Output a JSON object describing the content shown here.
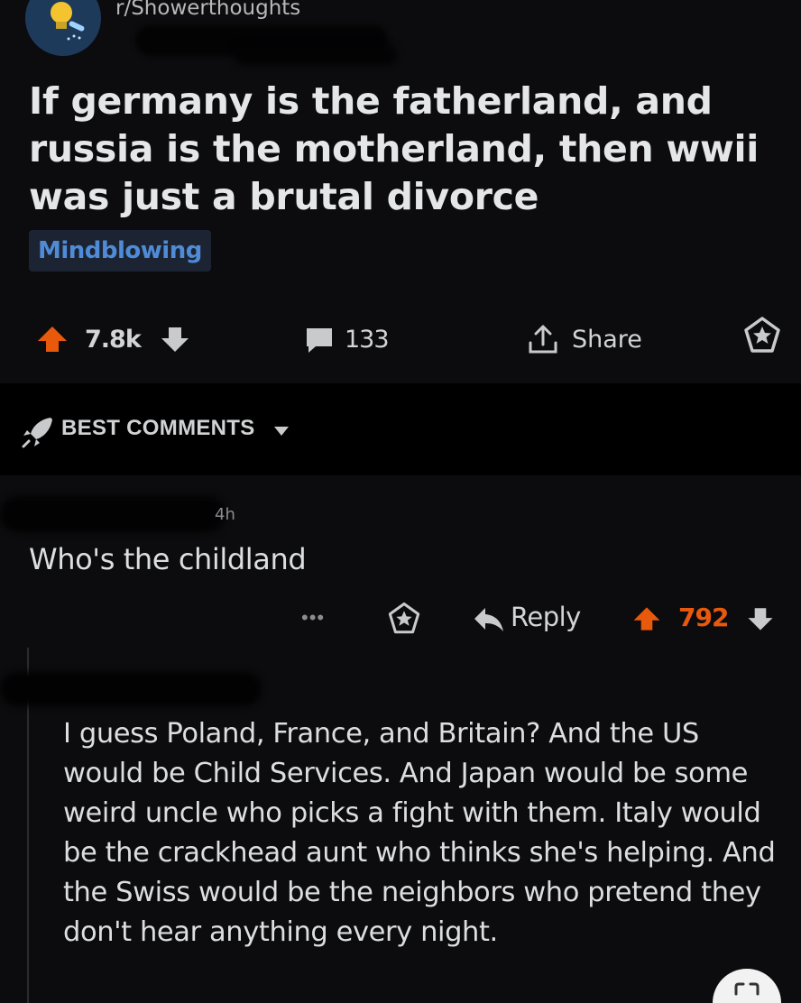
{
  "post": {
    "subreddit": "r/Showerthoughts",
    "title": "If germany is the fatherland, and russia is the motherland, then wwii was just a brutal divorce",
    "flair": "Mindblowing",
    "votes": "7.8k",
    "comments": "133",
    "share_label": "Share"
  },
  "sort": {
    "label": "BEST COMMENTS"
  },
  "comments": [
    {
      "time": "4h",
      "body": "Who's the childland",
      "reply_label": "Reply",
      "votes": "792",
      "more": "•••"
    },
    {
      "body": "I guess Poland, France, and Britain? And the US would be Child Services. And Japan would be some weird uncle who picks a fight with them. Italy would be the crackhead aunt who thinks she's helping. And the Swiss would be the neighbors who pretend they don't hear anything every night."
    }
  ],
  "colors": {
    "background": "#0c0c0e",
    "upvote_active": "#e8590c",
    "flair_text": "#4f8bd6",
    "flair_bg": "#1c2433",
    "sort_bar_bg": "#000000"
  },
  "icons": {
    "upvote": "arrow-up-icon",
    "downvote": "arrow-down-icon",
    "comment": "speech-bubble-icon",
    "share": "share-icon",
    "award": "award-icon",
    "sort": "rocket-icon",
    "reply": "reply-arrow-icon",
    "more": "ellipsis-icon",
    "lens": "lens-icon"
  }
}
